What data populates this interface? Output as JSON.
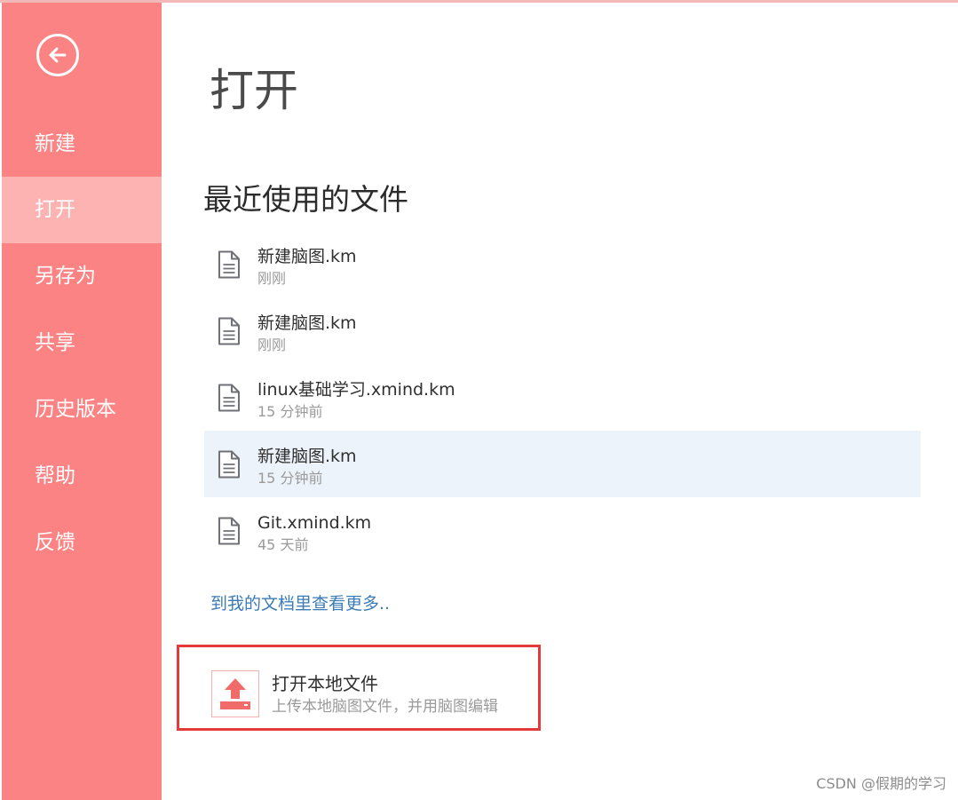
{
  "sidebar": {
    "items": [
      {
        "label": "新建",
        "active": false
      },
      {
        "label": "打开",
        "active": true
      },
      {
        "label": "另存为",
        "active": false
      },
      {
        "label": "共享",
        "active": false
      },
      {
        "label": "历史版本",
        "active": false
      },
      {
        "label": "帮助",
        "active": false
      },
      {
        "label": "反馈",
        "active": false
      }
    ]
  },
  "main": {
    "title": "打开",
    "recent_title": "最近使用的文件",
    "files": [
      {
        "name": "新建脑图.km",
        "time": "刚刚",
        "selected": false
      },
      {
        "name": "新建脑图.km",
        "time": "刚刚",
        "selected": false
      },
      {
        "name": "linux基础学习.xmind.km",
        "time": "15 分钟前",
        "selected": false
      },
      {
        "name": "新建脑图.km",
        "time": "15 分钟前",
        "selected": true
      },
      {
        "name": "Git.xmind.km",
        "time": "45 天前",
        "selected": false
      }
    ],
    "more_link": "到我的文档里查看更多..",
    "open_local": {
      "title": "打开本地文件",
      "description": "上传本地脑图文件，并用脑图编辑"
    }
  },
  "watermark": "CSDN @假期的学习",
  "colors": {
    "sidebar_bg": "#fc8383",
    "sidebar_active": "#feb3b3",
    "selected_row": "#edf3fa",
    "link": "#3b7bb6",
    "highlight_border": "#e43a3a"
  },
  "icons": {
    "back": "arrow-left-circle-icon",
    "file": "document-icon",
    "upload": "upload-icon"
  }
}
